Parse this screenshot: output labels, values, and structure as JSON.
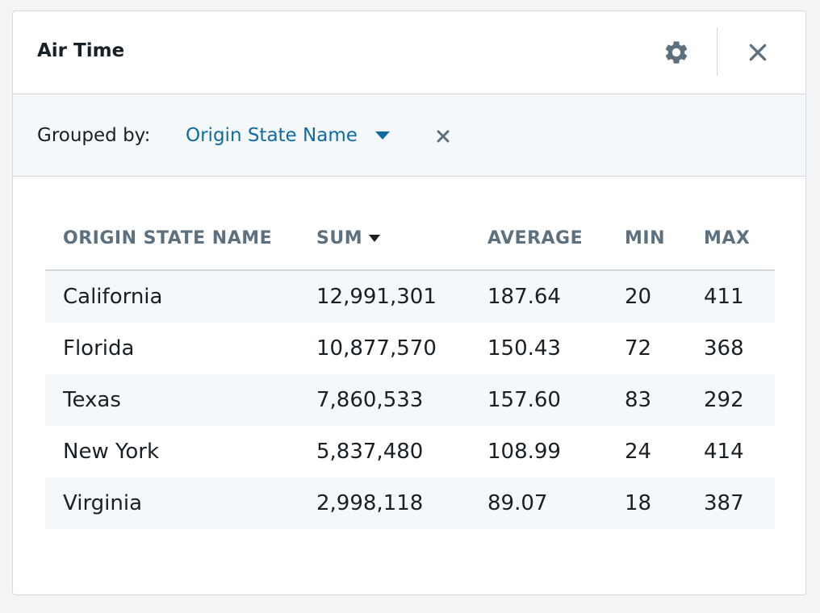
{
  "panel": {
    "title": "Air Time",
    "settings_icon": "gear-icon",
    "close_icon": "close-icon"
  },
  "grouping": {
    "label": "Grouped by:",
    "selected": "Origin State Name",
    "dropdown_icon": "caret-down-icon",
    "remove_icon": "close-icon"
  },
  "table": {
    "columns": [
      "ORIGIN STATE NAME",
      "SUM",
      "AVERAGE",
      "MIN",
      "MAX"
    ],
    "sorted_column": "SUM",
    "sort_direction": "descending",
    "rows": [
      [
        "California",
        "12,991,301",
        "187.64",
        "20",
        "411"
      ],
      [
        "Florida",
        "10,877,570",
        "150.43",
        "72",
        "368"
      ],
      [
        "Texas",
        "7,860,533",
        "157.60",
        "83",
        "292"
      ],
      [
        "New York",
        "5,837,480",
        "108.99",
        "24",
        "414"
      ],
      [
        "Virginia",
        "2,998,118",
        "89.07",
        "18",
        "387"
      ]
    ]
  },
  "colors": {
    "accent": "#106ba3",
    "header_text": "#5c7080",
    "text": "#182026",
    "stripe": "#f5f8fa",
    "border": "#d3d8de"
  }
}
